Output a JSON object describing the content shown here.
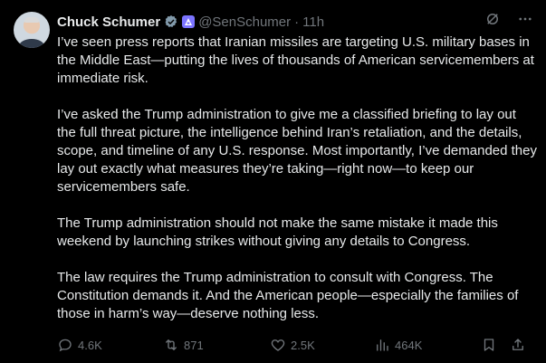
{
  "author": {
    "name": "Chuck Schumer",
    "handle": "@SenSchumer",
    "separator": "·",
    "time": "11h"
  },
  "icons": {
    "verified": "gray-verified-check-icon",
    "affiliation": "us-senate-affiliation-icon",
    "grok": "grok-icon",
    "more": "more-icon",
    "reply": "reply-icon",
    "repost": "repost-icon",
    "like": "heart-icon",
    "views": "views-icon",
    "bookmark": "bookmark-icon",
    "share": "share-icon"
  },
  "colors": {
    "background": "#000000",
    "text": "#e7e9ea",
    "muted": "#71767b",
    "affiliation_badge": "#7b74ff"
  },
  "tweet": {
    "paragraphs": [
      "I’ve seen press reports that Iranian missiles are targeting U.S. military bases in the Middle East—putting the lives of thousands of American servicemembers at immediate risk.",
      "I’ve asked the Trump administration to give me a classified briefing to lay out the full threat picture, the intelligence behind Iran’s retaliation, and the details, scope, and timeline of any U.S. response. Most importantly, I’ve demanded they lay out exactly what measures they’re taking—right now—to keep our servicemembers safe.",
      "The Trump administration should not make the same mistake it made this weekend by launching strikes without giving any details to Congress.",
      "The law requires the Trump administration to consult with Congress. The Constitution demands it. And the American people—especially the families of those in harm’s way—deserve nothing less."
    ]
  },
  "metrics": {
    "replies": "4.6K",
    "reposts": "871",
    "likes": "2.5K",
    "views": "464K"
  }
}
